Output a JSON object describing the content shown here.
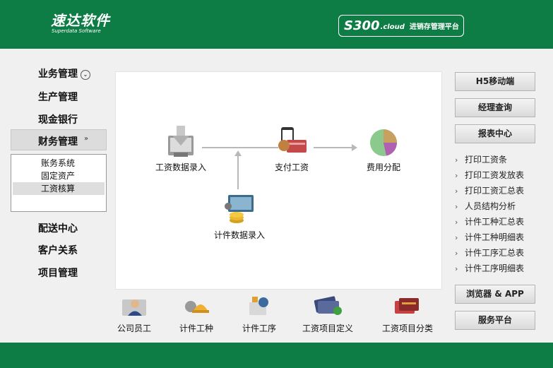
{
  "header": {
    "logo_cn": "速达软件",
    "logo_en": "Superdata Software",
    "brand_main": "S300",
    "brand_sub": ".cloud",
    "brand_cn": "进销存管理平台"
  },
  "nav": {
    "items": [
      {
        "label": "业务管理",
        "chevron": "⌄"
      },
      {
        "label": "生产管理"
      },
      {
        "label": "现金银行"
      },
      {
        "label": "财务管理",
        "chevron": "⌄"
      },
      {
        "label": "配送中心"
      },
      {
        "label": "客户关系"
      },
      {
        "label": "项目管理"
      }
    ],
    "submenu": [
      "账务系统",
      "固定资产",
      "工资核算"
    ],
    "selected_submenu": "工资核算"
  },
  "flow": {
    "salary_entry": "工资数据录入",
    "pay_salary": "支付工资",
    "cost_alloc": "费用分配",
    "piece_entry": "计件数据录入"
  },
  "quick": [
    "公司员工",
    "计件工种",
    "计件工序",
    "工资项目定义",
    "工资项目分类"
  ],
  "right": {
    "h5": "H5移动端",
    "manager": "经理查询",
    "reports": "报表中心",
    "links": [
      "打印工资条",
      "打印工资发放表",
      "打印工资汇总表",
      "人员结构分析",
      "计件工种汇总表",
      "计件工种明细表",
      "计件工序汇总表",
      "计件工序明细表"
    ],
    "browser_app": "浏览器 & APP",
    "service": "服务平台"
  },
  "colors": {
    "header_green": "#0d7d45",
    "panel_bg": "#ffffff",
    "page_bg": "#f0f0f0"
  }
}
